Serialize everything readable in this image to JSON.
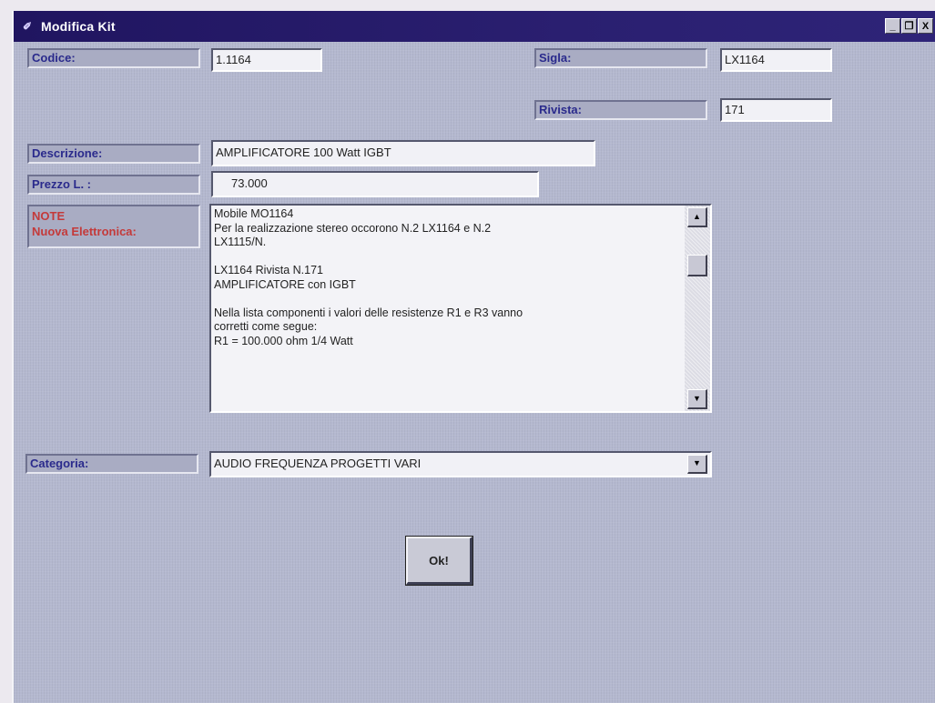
{
  "window": {
    "title": "Modifica Kit",
    "controls": {
      "minimize": "_",
      "restore": "❐",
      "close": "X"
    }
  },
  "form": {
    "codice_label": "Codice:",
    "codice_value": "1.1164",
    "sigla_label": "Sigla:",
    "sigla_value": "LX1164",
    "rivista_label": "Rivista:",
    "rivista_value": "171",
    "descrizione_label": "Descrizione:",
    "descrizione_value": "AMPLIFICATORE 100 Watt IGBT",
    "prezzo_label": "Prezzo L. :",
    "prezzo_value": "73.000",
    "note_label_line1": "NOTE",
    "note_label_line2": "Nuova Elettronica:",
    "note_lines": [
      "Mobile MO1164",
      "Per la realizzazione stereo occorono N.2 LX1164 e N.2",
      "LX1115/N.",
      "",
      "LX1164 Rivista N.171",
      "AMPLIFICATORE con IGBT",
      "",
      "Nella lista componenti i valori delle resistenze R1 e R3 vanno",
      "corretti come segue:",
      "R1 = 100.000 ohm 1/4 Watt"
    ],
    "categoria_label": "Categoria:",
    "categoria_value": "AUDIO FREQUENZA PROGETTI VARI"
  },
  "buttons": {
    "ok_label": "Ok!"
  },
  "icons": {
    "scroll_up": "▲",
    "scroll_down": "▼",
    "dropdown": "▼",
    "app": "✐"
  }
}
